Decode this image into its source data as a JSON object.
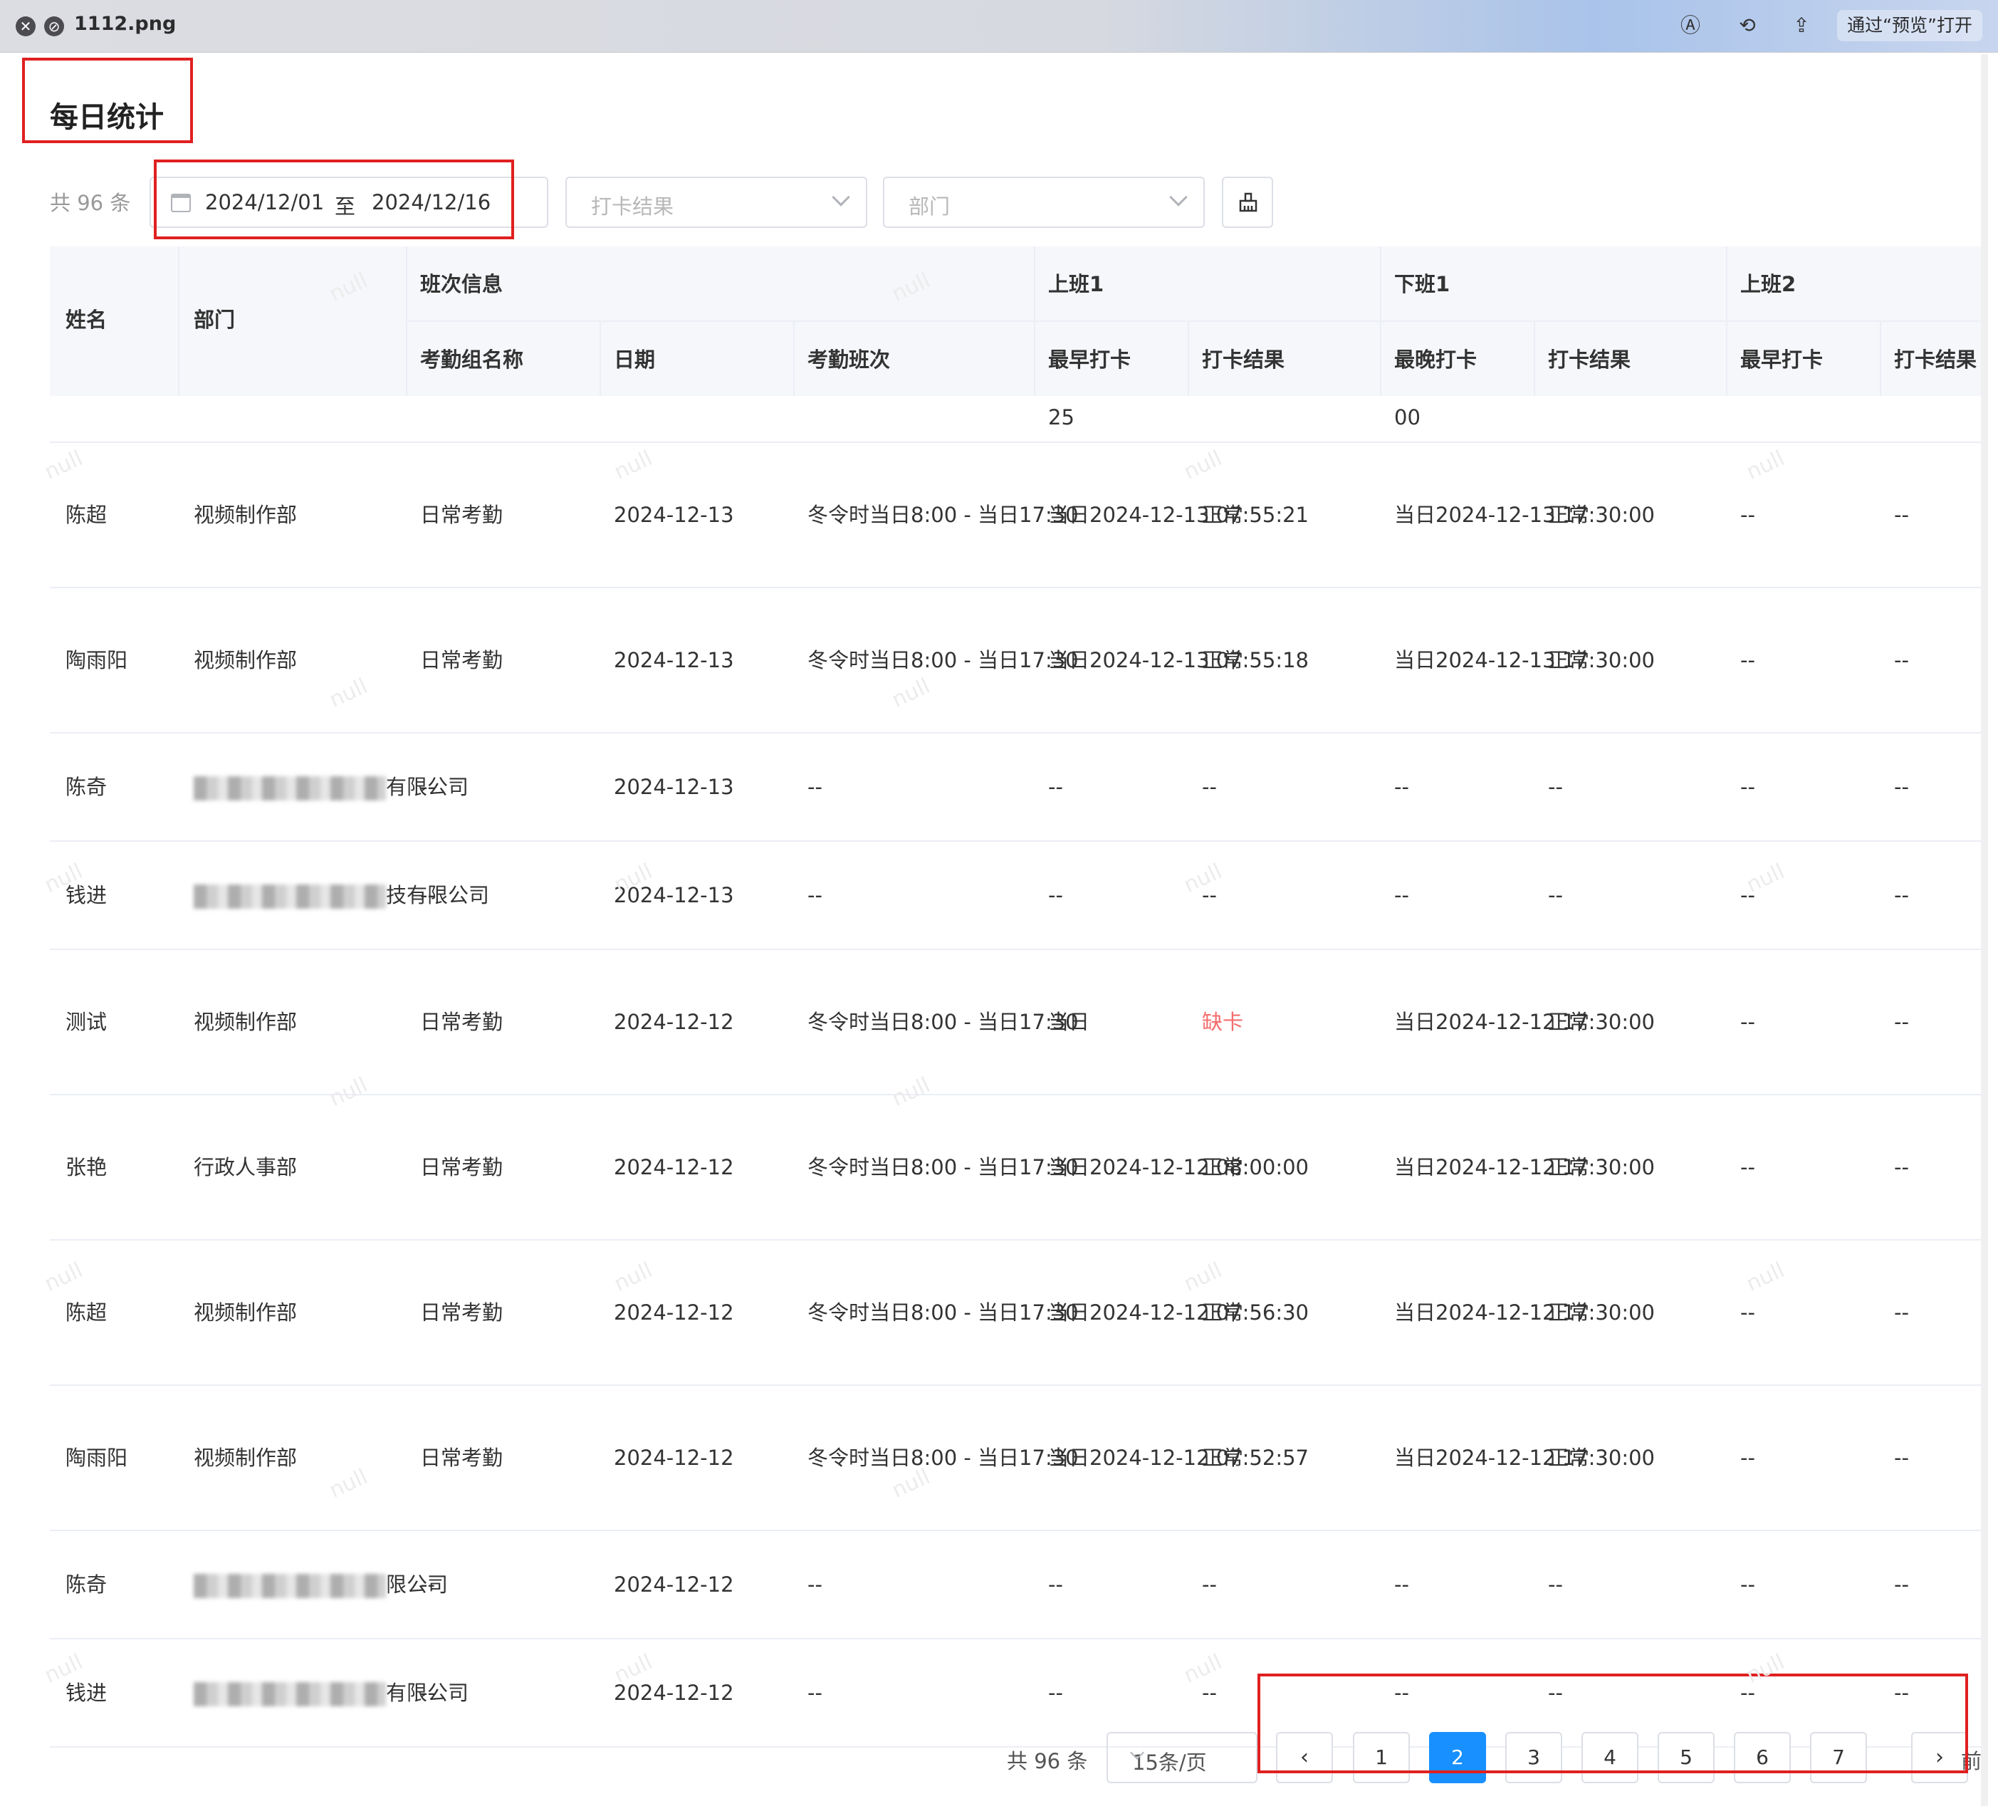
{
  "window": {
    "filename": "1112.png",
    "open_with": "通过“预览”打开"
  },
  "page": {
    "title": "每日统计"
  },
  "filters": {
    "total": "共 96 条",
    "date_start": "2024/12/01",
    "date_sep": "至",
    "date_end": "2024/12/16",
    "punch_result_placeholder": "打卡结果",
    "department_placeholder": "部门"
  },
  "table": {
    "group_headers": {
      "shift_info": "班次信息",
      "on1": "上班1",
      "off1": "下班1",
      "on2": "上班2"
    },
    "headers": {
      "name": "姓名",
      "dept": "部门",
      "group_name": "考勤组名称",
      "date": "日期",
      "shift": "考勤班次",
      "on1_earliest": "最早打卡",
      "on1_result": "打卡结果",
      "off1_latest": "最晚打卡",
      "off1_result": "打卡结果",
      "on2_earliest": "最早打卡",
      "on2_result": "打卡结果"
    },
    "partial_row": {
      "on1_tail": "25",
      "off1_tail": "00"
    },
    "rows": [
      {
        "name": "陈超",
        "dept": "视频制作部",
        "dept2": "",
        "group": "日常考勤",
        "date": "2024-12-13",
        "shift1": "冬令时",
        "shift2": "当日8:00 - 当日17:30",
        "on1_a": "当日2024-1",
        "on1_b": "2-13 07:55:",
        "on1_c": "21",
        "on1_res": "正常",
        "off1_a": "当日2024-1",
        "off1_b": "2-13 17:30:",
        "off1_c": "00",
        "off1_res": "正常",
        "on2": "--",
        "on2_res": "--"
      },
      {
        "name": "陶雨阳",
        "dept": "视频制作部",
        "dept2": "",
        "group": "日常考勤",
        "date": "2024-12-13",
        "shift1": "冬令时",
        "shift2": "当日8:00 - 当日17:30",
        "on1_a": "当日2024-1",
        "on1_b": "2-13 07:55:",
        "on1_c": "18",
        "on1_res": "正常",
        "off1_a": "当日2024-1",
        "off1_b": "2-13 17:30:",
        "off1_c": "00",
        "off1_res": "正常",
        "on2": "--",
        "on2_res": "--"
      },
      {
        "name": "陈奇",
        "dept": "有",
        "dept2": "限公司",
        "group": "--",
        "date": "2024-12-13",
        "shift1": "--",
        "shift2": "",
        "on1_a": "--",
        "on1_b": "",
        "on1_c": "",
        "on1_res": "--",
        "off1_a": "--",
        "off1_b": "",
        "off1_c": "",
        "off1_res": "--",
        "on2": "--",
        "on2_res": "--"
      },
      {
        "name": "钱进",
        "dept": "技有",
        "dept2": "限公司",
        "group": "--",
        "date": "2024-12-13",
        "shift1": "--",
        "shift2": "",
        "on1_a": "--",
        "on1_b": "",
        "on1_c": "",
        "on1_res": "--",
        "off1_a": "--",
        "off1_b": "",
        "off1_c": "",
        "off1_res": "--",
        "on2": "--",
        "on2_res": "--"
      },
      {
        "name": "测试",
        "dept": "视频制作部",
        "dept2": "",
        "group": "日常考勤",
        "date": "2024-12-12",
        "shift1": "冬令时",
        "shift2": "当日8:00 - 当日17:30",
        "on1_a": "当日",
        "on1_b": "",
        "on1_c": "",
        "on1_res": "缺卡",
        "off1_a": "当日2024-1",
        "off1_b": "2-12 17:30:",
        "off1_c": "00",
        "off1_res": "正常",
        "on2": "--",
        "on2_res": "--"
      },
      {
        "name": "张艳",
        "dept": "行政人事部",
        "dept2": "",
        "group": "日常考勤",
        "date": "2024-12-12",
        "shift1": "冬令时",
        "shift2": "当日8:00 - 当日17:30",
        "on1_a": "当日2024-1",
        "on1_b": "2-12 08:00:",
        "on1_c": "00",
        "on1_res": "正常",
        "off1_a": "当日2024-1",
        "off1_b": "2-12 17:30:",
        "off1_c": "00",
        "off1_res": "正常",
        "on2": "--",
        "on2_res": "--"
      },
      {
        "name": "陈超",
        "dept": "视频制作部",
        "dept2": "",
        "group": "日常考勤",
        "date": "2024-12-12",
        "shift1": "冬令时",
        "shift2": "当日8:00 - 当日17:30",
        "on1_a": "当日2024-1",
        "on1_b": "2-12 07:56:",
        "on1_c": "30",
        "on1_res": "正常",
        "off1_a": "当日2024-1",
        "off1_b": "2-12 17:30:",
        "off1_c": "00",
        "off1_res": "正常",
        "on2": "--",
        "on2_res": "--"
      },
      {
        "name": "陶雨阳",
        "dept": "视频制作部",
        "dept2": "",
        "group": "日常考勤",
        "date": "2024-12-12",
        "shift1": "冬令时",
        "shift2": "当日8:00 - 当日17:30",
        "on1_a": "当日2024-1",
        "on1_b": "2-12 07:52:",
        "on1_c": "57",
        "on1_res": "正常",
        "off1_a": "当日2024-1",
        "off1_b": "2-12 17:30:",
        "off1_c": "00",
        "off1_res": "正常",
        "on2": "--",
        "on2_res": "--"
      },
      {
        "name": "陈奇",
        "dept": "",
        "dept2": "限公司",
        "group": "--",
        "date": "2024-12-12",
        "shift1": "--",
        "shift2": "",
        "on1_a": "--",
        "on1_b": "",
        "on1_c": "",
        "on1_res": "--",
        "off1_a": "--",
        "off1_b": "",
        "off1_c": "",
        "off1_res": "--",
        "on2": "--",
        "on2_res": "--"
      },
      {
        "name": "钱进",
        "dept": "有",
        "dept2": "限公司",
        "group": "--",
        "date": "2024-12-12",
        "shift1": "--",
        "shift2": "",
        "on1_a": "--",
        "on1_b": "",
        "on1_c": "",
        "on1_res": "--",
        "off1_a": "--",
        "off1_b": "",
        "off1_c": "",
        "off1_res": "--",
        "on2": "--",
        "on2_res": "--"
      }
    ]
  },
  "watermark": "null",
  "pagination": {
    "total": "共 96 条",
    "page_size": "15条/页",
    "prev": "‹",
    "next": "›",
    "pages": [
      "1",
      "2",
      "3",
      "4",
      "5",
      "6",
      "7"
    ],
    "current": "2",
    "goto": "前往"
  },
  "colors": {
    "accent": "#1890ff",
    "annotation_red": "#e02020",
    "missing_red": "#f56c6c",
    "header_bg": "#f5f7fa"
  }
}
